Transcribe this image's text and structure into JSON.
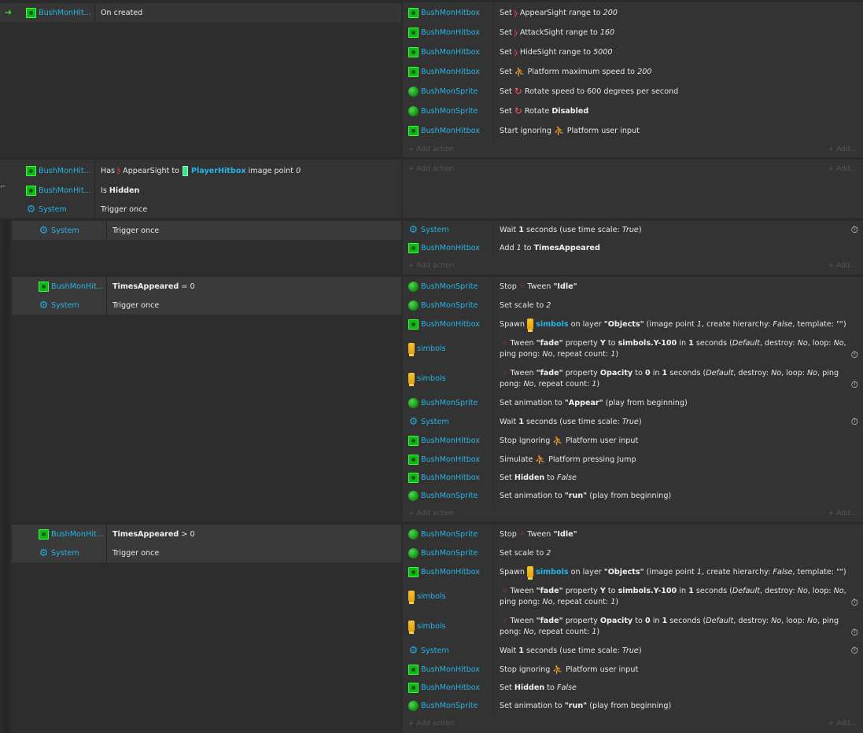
{
  "colors": {
    "object": "#27b4e6",
    "hitbox_icon": "#13b51a",
    "system_icon": "#29a3d6",
    "behavior_icon": "#ff4a4a"
  },
  "icons": {
    "hitbox": "green-square-icon",
    "sprite": "green-ball-icon",
    "system": "gear-icon",
    "symbol": "yellow-marker-icon",
    "sight": "radar-waves-icon",
    "platform": "running-man-icon",
    "rotate": "rotate-icon",
    "tween": "tween-dots-icon",
    "timer": "stopwatch-icon",
    "arrow": "arrow-right-icon"
  },
  "labels": {
    "add_action": "+ Add action",
    "add_more": "+ Add..."
  },
  "ev1": {
    "c1_obj": "BushMonHit...",
    "c1_txt": "On created",
    "a1_obj": "BushMonHitbox",
    "a1_pre": "Set",
    "a1_post": "AppearSight range to",
    "a1_val": "200",
    "a2_obj": "BushMonHitbox",
    "a2_pre": "Set",
    "a2_post": "AttackSight range to",
    "a2_val": "160",
    "a3_obj": "BushMonHitbox",
    "a3_pre": "Set",
    "a3_post": "HideSight range to",
    "a3_val": "5000",
    "a4_obj": "BushMonHitbox",
    "a4_pre": "Set",
    "a4_post": "Platform maximum speed to",
    "a4_val": "200",
    "a5_obj": "BushMonSprite",
    "a5_pre": "Set",
    "a5_post": "Rotate speed to 600 degrees per second",
    "a6_obj": "BushMonSprite",
    "a6_pre": "Set",
    "a6_post": "Rotate",
    "a6_val": "Disabled",
    "a7_obj": "BushMonHitbox",
    "a7_pre": "Start ignoring",
    "a7_post": "Platform user input"
  },
  "ev2": {
    "c1_obj": "BushMonHit...",
    "c1_pre": "Has",
    "c1_mid": "AppearSight to",
    "c1_target": "PlayerHitbox",
    "c1_post": "image point",
    "c1_val": "0",
    "c2_obj": "BushMonHit...",
    "c2_pre": "Is",
    "c2_val": "Hidden",
    "c3_obj": "System",
    "c3_txt": "Trigger once"
  },
  "ev3": {
    "c1_obj": "System",
    "c1_txt": "Trigger once",
    "a1_obj": "System",
    "a1_pre": "Wait",
    "a1_num": "1",
    "a1_mid": "seconds (use time scale:",
    "a1_val": "True",
    "a1_end": ")",
    "a2_obj": "BushMonHitbox",
    "a2_pre": "Add",
    "a2_num": "1",
    "a2_mid": "to",
    "a2_val": "TimesAppeared"
  },
  "ev4": {
    "c1_obj": "BushMonHit...",
    "c1_var": "TimesAppeared",
    "c1_op": "= 0",
    "c2_obj": "System",
    "c2_txt": "Trigger once",
    "a1_obj": "BushMonSprite",
    "a1_pre": "Stop",
    "a1_mid": "Tween",
    "a1_val": "\"Idle\"",
    "a2_obj": "BushMonSprite",
    "a2_pre": "Set scale to",
    "a2_val": "2",
    "a3_obj": "BushMonHitbox",
    "a3_pre": "Spawn",
    "a3_kw": "simbols",
    "a3_mid": "on layer",
    "a3_layer": "\"Objects\"",
    "a3_p1": "(image point",
    "a3_ip": "1",
    "a3_p2": ", create hierarchy:",
    "a3_ch": "False",
    "a3_p3": ", template: \"\")",
    "a4_obj": "simbols",
    "a4_pre": "Tween",
    "a4_name": "\"fade\"",
    "a4_p1": "property",
    "a4_prop": "Y",
    "a4_p2": "to",
    "a4_val": "simbols.Y-100",
    "a4_p3": "in",
    "a4_dur": "1",
    "a4_p4": "seconds (",
    "a4_ease": "Default",
    "a4_p5": ", destroy:",
    "a4_d": "No",
    "a4_p6": ", loop:",
    "a4_l": "No",
    "a4_p7": ", ping pong:",
    "a4_pp": "No",
    "a4_p8": ", repeat count:",
    "a4_rc": "1",
    "a4_p9": ")",
    "a5_obj": "simbols",
    "a5_pre": "Tween",
    "a5_name": "\"fade\"",
    "a5_p1": "property",
    "a5_prop": "Opacity",
    "a5_p2": "to",
    "a5_val": "0",
    "a5_p3": "in",
    "a5_dur": "1",
    "a5_p4": "seconds (",
    "a5_ease": "Default",
    "a5_p5": ", destroy:",
    "a5_d": "No",
    "a5_p6": ", loop:",
    "a5_l": "No",
    "a5_p7": ", ping pong:",
    "a5_pp": "No",
    "a5_p8": ", repeat count:",
    "a5_rc": "1",
    "a5_p9": ")",
    "a6_obj": "BushMonSprite",
    "a6_pre": "Set animation to",
    "a6_val": "\"Appear\"",
    "a6_post": "(play from beginning)",
    "a7_obj": "System",
    "a7_pre": "Wait",
    "a7_num": "1",
    "a7_mid": "seconds (use time scale:",
    "a7_val": "True",
    "a7_end": ")",
    "a8_obj": "BushMonHitbox",
    "a8_pre": "Stop ignoring",
    "a8_post": "Platform user input",
    "a9_obj": "BushMonHitbox",
    "a9_pre": "Simulate",
    "a9_post": "Platform pressing Jump",
    "a10_obj": "BushMonHitbox",
    "a10_pre": "Set",
    "a10_var": "Hidden",
    "a10_mid": "to",
    "a10_val": "False",
    "a11_obj": "BushMonSprite",
    "a11_pre": "Set animation to",
    "a11_val": "\"run\"",
    "a11_post": "(play from beginning)"
  },
  "ev5": {
    "c1_obj": "BushMonHit...",
    "c1_var": "TimesAppeared",
    "c1_op": "> 0",
    "c2_obj": "System",
    "c2_txt": "Trigger once",
    "a1_obj": "BushMonSprite",
    "a1_pre": "Stop",
    "a1_mid": "Tween",
    "a1_val": "\"Idle\"",
    "a2_obj": "BushMonSprite",
    "a2_pre": "Set scale to",
    "a2_val": "2",
    "a3_obj": "BushMonHitbox",
    "a3_pre": "Spawn",
    "a3_kw": "simbols",
    "a3_mid": "on layer",
    "a3_layer": "\"Objects\"",
    "a3_p1": "(image point",
    "a3_ip": "1",
    "a3_p2": ", create hierarchy:",
    "a3_ch": "False",
    "a3_p3": ", template: \"\")",
    "a4_obj": "simbols",
    "a4_pre": "Tween",
    "a4_name": "\"fade\"",
    "a4_p1": "property",
    "a4_prop": "Y",
    "a4_p2": "to",
    "a4_val": "simbols.Y-100",
    "a4_p3": "in",
    "a4_dur": "1",
    "a4_p4": "seconds (",
    "a4_ease": "Default",
    "a4_p5": ", destroy:",
    "a4_d": "No",
    "a4_p6": ", loop:",
    "a4_l": "No",
    "a4_p7": ", ping pong:",
    "a4_pp": "No",
    "a4_p8": ", repeat count:",
    "a4_rc": "1",
    "a4_p9": ")",
    "a5_obj": "simbols",
    "a5_pre": "Tween",
    "a5_name": "\"fade\"",
    "a5_p1": "property",
    "a5_prop": "Opacity",
    "a5_p2": "to",
    "a5_val": "0",
    "a5_p3": "in",
    "a5_dur": "1",
    "a5_p4": "seconds (",
    "a5_ease": "Default",
    "a5_p5": ", destroy:",
    "a5_d": "No",
    "a5_p6": ", loop:",
    "a5_l": "No",
    "a5_p7": ", ping pong:",
    "a5_pp": "No",
    "a5_p8": ", repeat count:",
    "a5_rc": "1",
    "a5_p9": ")",
    "a6_obj": "System",
    "a6_pre": "Wait",
    "a6_num": "1",
    "a6_mid": "seconds (use time scale:",
    "a6_val": "True",
    "a6_end": ")",
    "a7_obj": "BushMonHitbox",
    "a7_pre": "Stop ignoring",
    "a7_post": "Platform user input",
    "a8_obj": "BushMonHitbox",
    "a8_pre": "Set",
    "a8_var": "Hidden",
    "a8_mid": "to",
    "a8_val": "False",
    "a9_obj": "BushMonSprite",
    "a9_pre": "Set animation to",
    "a9_val": "\"run\"",
    "a9_post": "(play from beginning)"
  }
}
